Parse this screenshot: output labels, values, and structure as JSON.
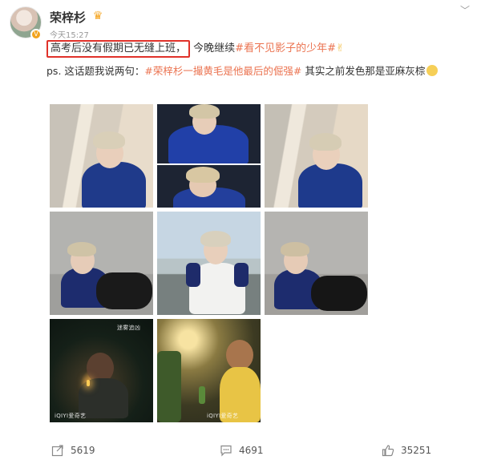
{
  "post": {
    "author": {
      "name": "荣梓杉",
      "time": "今天15:27"
    },
    "text": {
      "highlighted": "高考后没有假期已无缝上班，",
      "line1_rest": "今晚继续",
      "topic1": "#看不见影子的少年#",
      "line2_prefix": "ps. 这话题我说两句：",
      "topic2": "#荣梓杉一撮黄毛是他最后的倔强#",
      "line2_suffix": " 其实之前发色那是亚麻灰棕"
    },
    "photos": {
      "watermarks": [
        "迷雾追凶",
        "iQIYI爱奇艺",
        "iQIYI爱奇艺"
      ]
    },
    "actions": {
      "repost_count": "5619",
      "comment_count": "4691",
      "like_count": "35251"
    }
  },
  "colors": {
    "highlight_border": "#e0322a",
    "topic": "#eb7350",
    "verified_badge": "#f2a31d"
  },
  "icons": [
    "verified-icon",
    "crown-icon",
    "chevron-down-icon",
    "repost-icon",
    "comment-icon",
    "like-icon"
  ]
}
